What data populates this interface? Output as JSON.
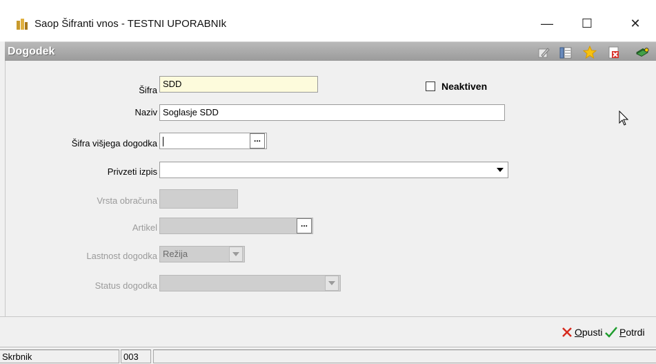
{
  "window": {
    "title": "Saop Šifranti vnos - TESTNI UPORABNIk",
    "minimize": "—",
    "maximize": "☐",
    "close": "✕"
  },
  "header": {
    "title": "Dogodek",
    "icons": [
      "edit-icon",
      "columns-icon",
      "favorite-star-icon",
      "delete-record-icon",
      "books-icon"
    ]
  },
  "form": {
    "sifra": {
      "label": "Šifra",
      "value": "SDD"
    },
    "neaktiven": {
      "label": "Neaktiven",
      "checked": false
    },
    "naziv": {
      "label": "Naziv",
      "value": "Soglasje SDD"
    },
    "sifra_visjega": {
      "label": "Šifra višjega dogodka",
      "value": "",
      "button": "..."
    },
    "privzeti_izpis": {
      "label": "Privzeti izpis",
      "value": ""
    },
    "vrsta_obracuna": {
      "label": "Vrsta obračuna",
      "value": ""
    },
    "artikel": {
      "label": "Artikel",
      "value": "",
      "button": "..."
    },
    "lastnost": {
      "label": "Lastnost dogodka",
      "value": "Režija"
    },
    "status": {
      "label": "Status dogodka",
      "value": ""
    }
  },
  "actions": {
    "cancel_rest": "pusti",
    "cancel_key": "O",
    "confirm_rest": "otrdi",
    "confirm_key": "P"
  },
  "statusbar": {
    "user_label": "Skrbnik",
    "user_code": "003",
    "message": ""
  },
  "colors": {
    "header_bg": "#a6a6a6",
    "required_field_bg": "#fdfbdc",
    "disabled_field_bg": "#cfcfcf"
  }
}
